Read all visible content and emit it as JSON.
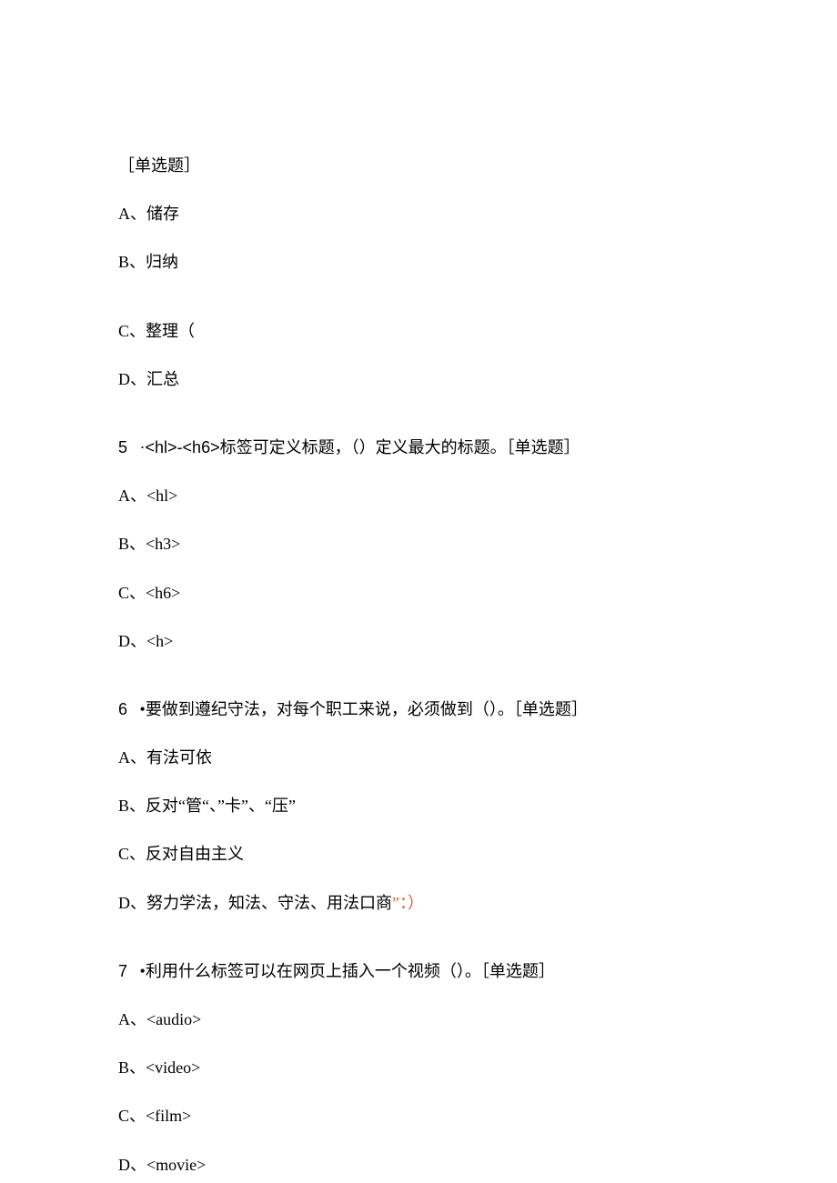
{
  "q4_partial": {
    "tag": "［单选题］",
    "optA": "A、储存",
    "optB": "B、归纳",
    "optC": "C、整理（",
    "optD": "D、汇总"
  },
  "q5": {
    "num": "5",
    "bullet": "·",
    "text_pre": "<hl>-<h6>",
    "text_mid": "标签可定义标题，（）定义最大的标题。［单选题］",
    "optA": "A、<hl>",
    "optB": "B、<h3>",
    "optC": "C、<h6>",
    "optD": "D、<h>"
  },
  "q6": {
    "num": "6",
    "bullet": "•",
    "text": "要做到遵纪守法，对每个职工来说，必须做到（）。［单选题］",
    "optA": "A、有法可依",
    "optB": "B、反对“管“、”卡”、“压”",
    "optC": "C、反对自由主义",
    "optD_pre": "D、努力学法，知法、守法、用法口商",
    "optD_red": "”：）"
  },
  "q7": {
    "num": "7",
    "bullet": "•",
    "text": "利用什么标签可以在网页上插入一个视频（）。［单选题］",
    "optA": "A、<audio>",
    "optB": "B、<video>",
    "optC": "C、<film>",
    "optD": "D、<movie>"
  }
}
